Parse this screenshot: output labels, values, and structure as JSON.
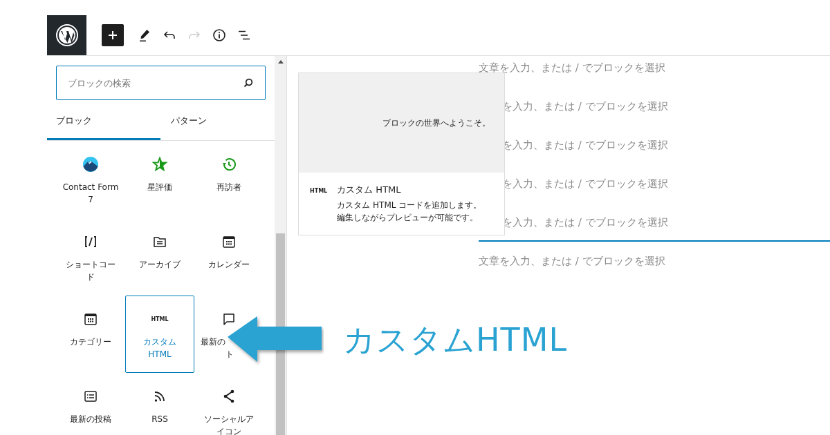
{
  "toolbar": {
    "buttons": [
      {
        "kind": "add",
        "disabled": false
      },
      {
        "kind": "edit",
        "disabled": false
      },
      {
        "kind": "undo",
        "disabled": false
      },
      {
        "kind": "redo",
        "disabled": true
      },
      {
        "kind": "info",
        "disabled": false
      },
      {
        "kind": "outline",
        "disabled": false
      }
    ]
  },
  "inserter": {
    "search": {
      "placeholder": "ブロックの検索"
    },
    "tabs": [
      {
        "label": "ブロック",
        "selected": true
      },
      {
        "label": "パターン",
        "selected": false
      }
    ],
    "blocks": [
      {
        "kind": "cf7",
        "lines": [
          "Contact Form",
          "7"
        ],
        "selected": false
      },
      {
        "kind": "star",
        "lines": [
          "星評価"
        ],
        "selected": false
      },
      {
        "kind": "history",
        "lines": [
          "再訪者"
        ],
        "selected": false
      },
      {
        "kind": "shortcode",
        "lines": [
          "ショートコー",
          "ド"
        ],
        "selected": false
      },
      {
        "kind": "archive",
        "lines": [
          "アーカイブ"
        ],
        "selected": false
      },
      {
        "kind": "calendar",
        "lines": [
          "カレンダー"
        ],
        "selected": false
      },
      {
        "kind": "calendar",
        "lines": [
          "カテゴリー"
        ],
        "selected": false
      },
      {
        "kind": "html",
        "icon_text": "HTML",
        "lines": [
          "カスタム",
          "HTML"
        ],
        "selected": true
      },
      {
        "kind": "comment",
        "lines": [
          "最新の",
          "ト"
        ],
        "selected": false
      },
      {
        "kind": "list",
        "lines": [
          "最新の投稿"
        ],
        "selected": false
      },
      {
        "kind": "rss",
        "lines": [
          "RSS"
        ],
        "selected": false
      },
      {
        "kind": "share",
        "lines": [
          "ソーシャルア",
          "イコン"
        ],
        "selected": false
      }
    ]
  },
  "preview_card": {
    "preview_text": "ブロックの世界へようこそ。",
    "icon_text": "HTML",
    "title": "カスタム HTML",
    "description": [
      "カスタム HTML コードを追加します。",
      "編集しながらプレビューが可能です。"
    ]
  },
  "canvas": {
    "paragraphs": [
      {
        "placeholder": "文章を入力、または / でブロックを選択",
        "covered": false,
        "focused": false
      },
      {
        "placeholder": "を入力、または / でブロックを選択",
        "covered": true,
        "focused": false
      },
      {
        "placeholder": "を入力、または / でブロックを選択",
        "covered": true,
        "focused": false
      },
      {
        "placeholder": "を入力、または / でブロックを選択",
        "covered": true,
        "focused": false
      },
      {
        "placeholder": "を入力、または / でブロックを選択",
        "covered": true,
        "focused": true
      },
      {
        "placeholder": "文章を入力、または / でブロックを選択",
        "covered": false,
        "focused": false
      }
    ]
  },
  "callout": {
    "text": "カスタムHTML"
  }
}
